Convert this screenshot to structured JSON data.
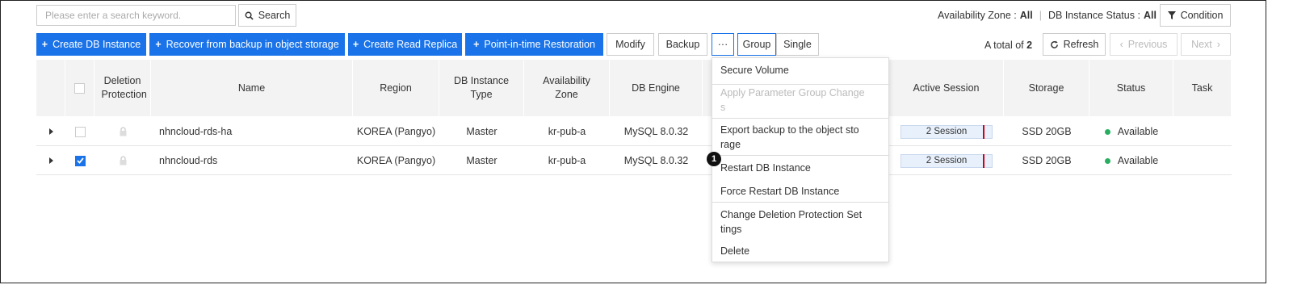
{
  "search": {
    "placeholder": "Please enter a search keyword.",
    "button_label": "Search"
  },
  "filters": {
    "availability_zone_label": "Availability Zone :",
    "availability_zone_value": "All",
    "status_label": "DB Instance Status :",
    "status_value": "All",
    "condition_label": "Condition"
  },
  "toolbar": {
    "create_db_instance": "Create DB Instance",
    "recover_backup": "Recover from backup in object storage",
    "create_read_replica": "Create Read Replica",
    "point_in_time": "Point-in-time Restoration",
    "modify": "Modify",
    "backup": "Backup",
    "more": "···",
    "group": "Group",
    "single": "Single"
  },
  "pagination": {
    "total_prefix": "A total of",
    "total_count": "2",
    "refresh": "Refresh",
    "previous": "Previous",
    "next": "Next"
  },
  "table": {
    "columns": [
      "Deletion Protection",
      "Name",
      "Region",
      "DB Instance Type",
      "Availability Zone",
      "DB Engine",
      "Active Session",
      "Storage",
      "Status",
      "Task"
    ],
    "rows": [
      {
        "checked": false,
        "name": "nhncloud-rds-ha",
        "region": "KOREA (Pangyo)",
        "type": "Master",
        "zone": "kr-pub-a",
        "engine": "MySQL 8.0.32",
        "session": "2 Session",
        "storage": "SSD 20GB",
        "status": "Available",
        "task": ""
      },
      {
        "checked": true,
        "name": "nhncloud-rds",
        "region": "KOREA (Pangyo)",
        "type": "Master",
        "zone": "kr-pub-a",
        "engine": "MySQL 8.0.32",
        "session": "2 Session",
        "storage": "SSD 20GB",
        "status": "Available",
        "task": ""
      }
    ]
  },
  "menu": {
    "secure_volume": "Secure Volume",
    "apply_param_1": "Apply Parameter Group Change",
    "apply_param_2": "s",
    "export_backup_1": "Export backup to the object sto",
    "export_backup_2": "rage",
    "restart": "Restart DB Instance",
    "force_restart": "Force Restart DB Instance",
    "change_deletion_1": "Change Deletion Protection Set",
    "change_deletion_2": "tings",
    "delete": "Delete"
  },
  "callout": "1",
  "colors": {
    "primary": "#1a73e8",
    "status_available": "#27ae60",
    "session_marker": "#d0021b"
  }
}
